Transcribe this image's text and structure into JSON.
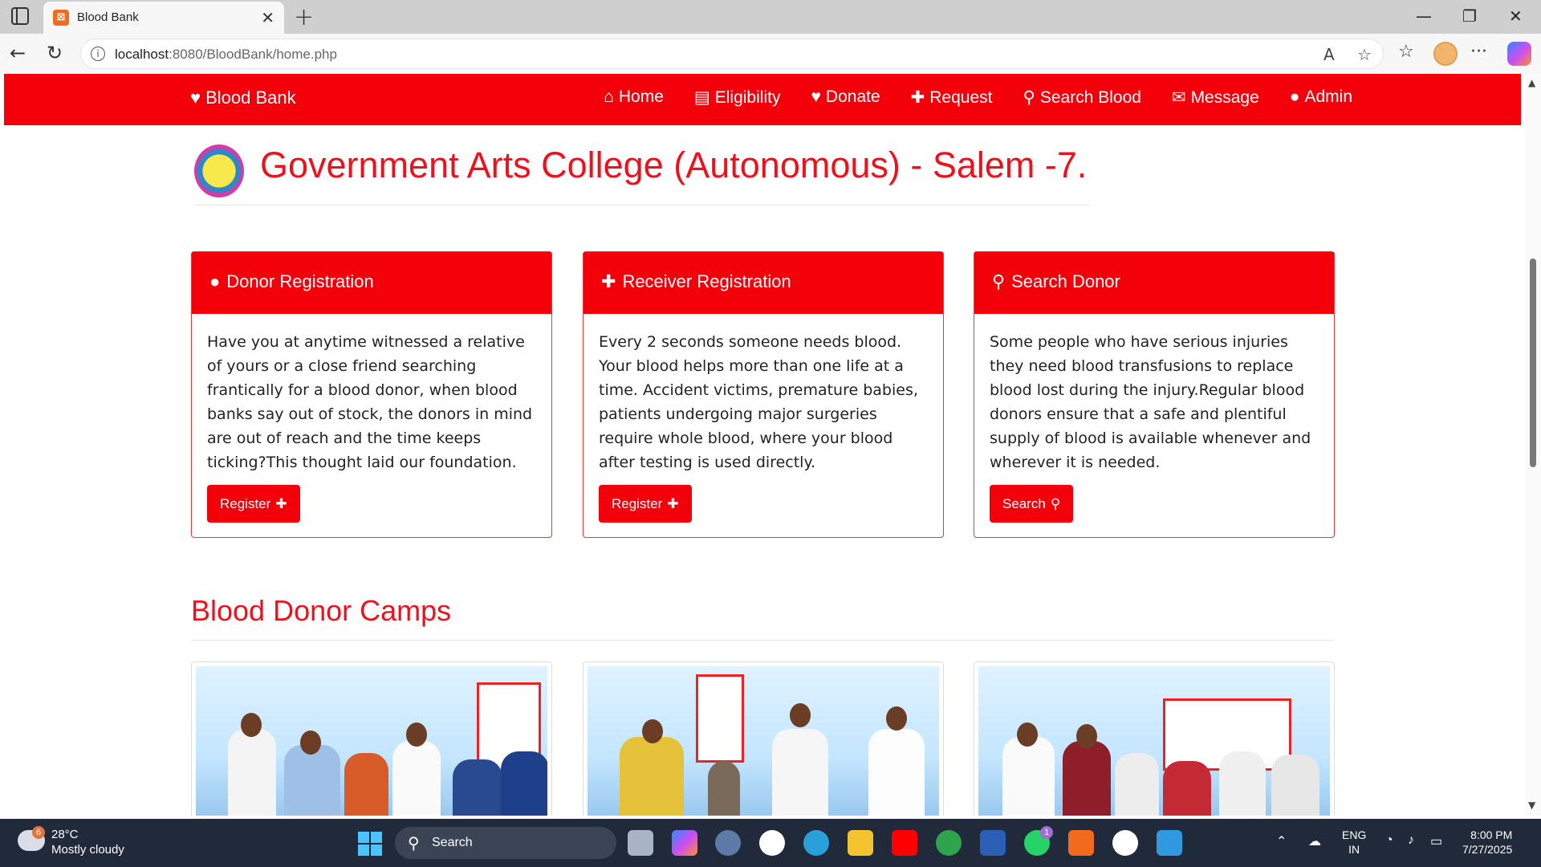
{
  "browser": {
    "tab_title": "Blood Bank",
    "url_host": "localhost",
    "url_rest": ":8080/BloodBank/home.php"
  },
  "navbar": {
    "brand": "Blood Bank",
    "links": [
      {
        "label": "Home",
        "icon": "home-icon"
      },
      {
        "label": "Eligibility",
        "icon": "clipboard-icon"
      },
      {
        "label": "Donate",
        "icon": "hand-holding-heart-icon"
      },
      {
        "label": "Request",
        "icon": "hospital-user-icon"
      },
      {
        "label": "Search Blood",
        "icon": "search-icon"
      },
      {
        "label": "Message",
        "icon": "envelope-icon"
      },
      {
        "label": "Admin",
        "icon": "user-icon"
      }
    ]
  },
  "college": {
    "title": "Government Arts College (Autonomous) - Salem -7."
  },
  "cards": [
    {
      "title": "Donor Registration",
      "icon": "user-icon",
      "text": "Have you at anytime witnessed a relative of yours or a close friend searching frantically for a blood donor, when blood banks say out of stock, the donors in mind are out of reach and the time keeps ticking?This thought laid our foundation.",
      "button": "Register",
      "button_icon": "user-plus-icon"
    },
    {
      "title": "Receiver Registration",
      "icon": "medkit-icon",
      "text": "Every 2 seconds someone needs blood. Your blood helps more than one life at a time. Accident victims, premature babies, patients undergoing major surgeries require whole blood, where your blood after testing is used directly.",
      "button": "Register",
      "button_icon": "user-plus-icon"
    },
    {
      "title": "Search Donor",
      "icon": "search-icon",
      "text": "Some people who have serious injuries they need blood transfusions to replace blood lost during the injury.Regular blood donors ensure that a safe and plentiful supply of blood is available whenever and wherever it is needed.",
      "button": "Search",
      "button_icon": "search-icon"
    }
  ],
  "camps": {
    "title": "Blood Donor Camps"
  },
  "taskbar": {
    "weather_badge": "6",
    "temperature": "28°C",
    "weather": "Mostly cloudy",
    "search_label": "Search",
    "whatsapp_badge": "1",
    "lang_top": "ENG",
    "lang_bottom": "IN",
    "time": "8:00 PM",
    "date": "7/27/2025"
  },
  "colors": {
    "brand_red": "#f4000b",
    "title_red": "#ee111d"
  }
}
